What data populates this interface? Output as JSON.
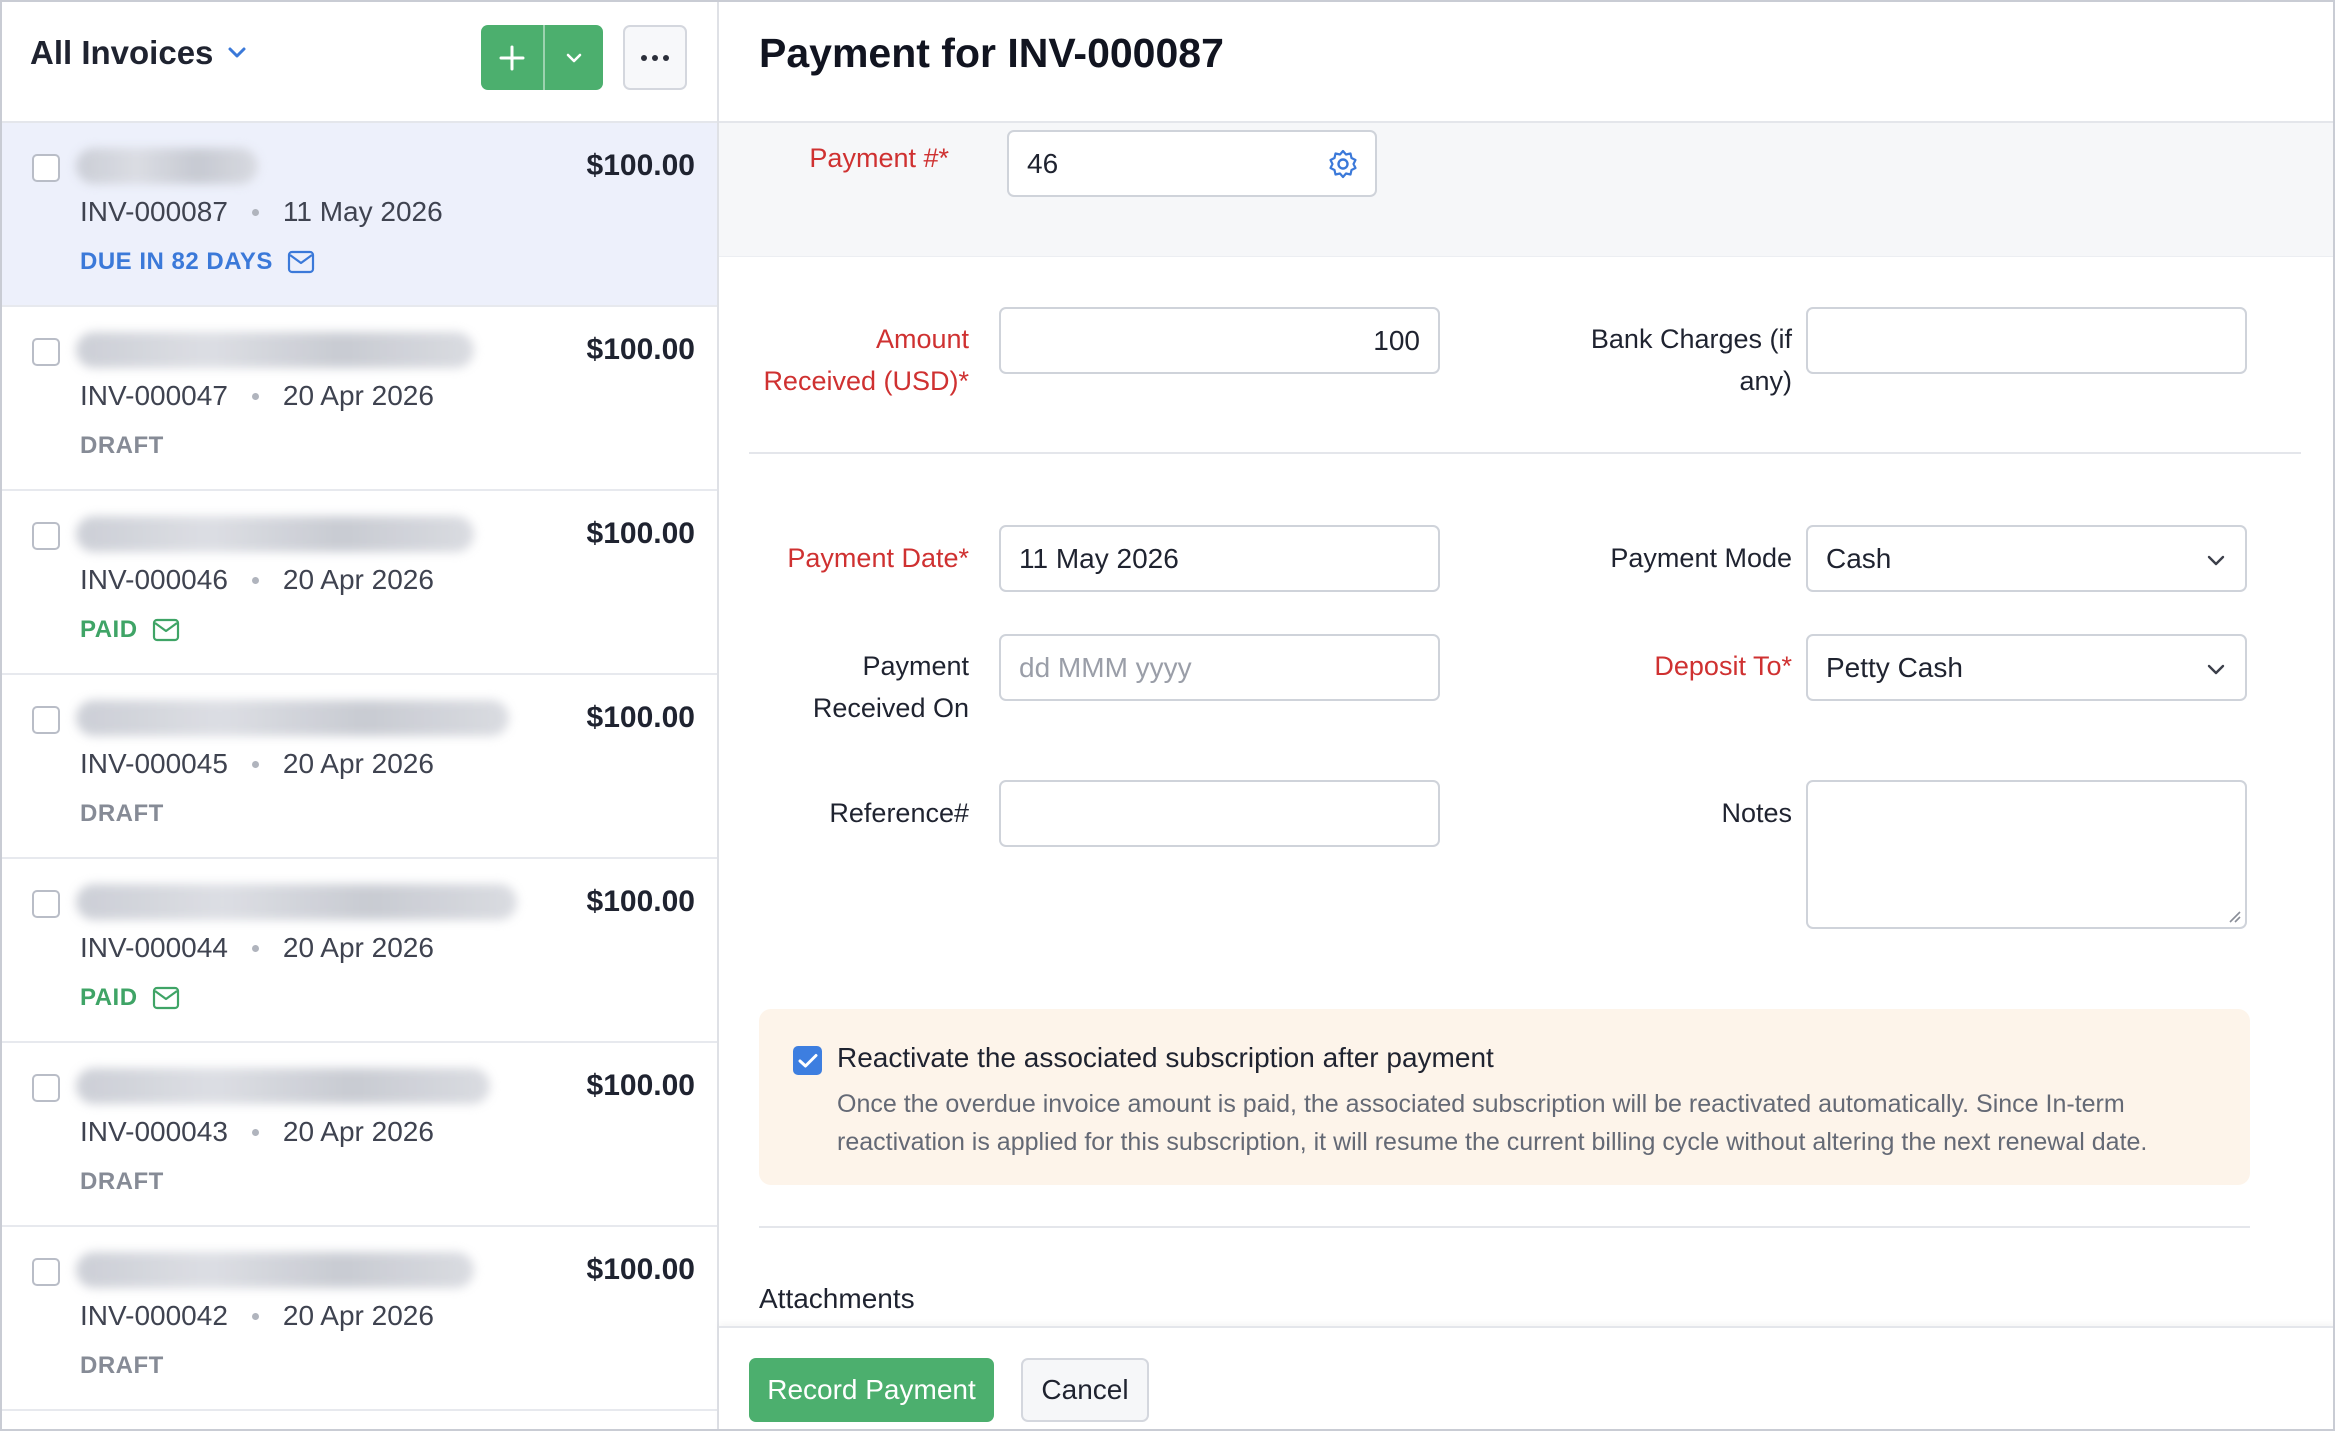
{
  "list": {
    "title": "All Invoices",
    "new_button_icon": "plus-icon",
    "more_button_icon": "ellipsis-icon",
    "invoices": [
      {
        "amount": "$100.00",
        "number": "INV-000087",
        "date": "11 May 2026",
        "status": "DUE IN 82 DAYS",
        "status_kind": "due",
        "emailed": true,
        "selected": true
      },
      {
        "amount": "$100.00",
        "number": "INV-000047",
        "date": "20 Apr 2026",
        "status": "DRAFT",
        "status_kind": "draft",
        "emailed": false,
        "selected": false
      },
      {
        "amount": "$100.00",
        "number": "INV-000046",
        "date": "20 Apr 2026",
        "status": "PAID",
        "status_kind": "paid",
        "emailed": true,
        "selected": false
      },
      {
        "amount": "$100.00",
        "number": "INV-000045",
        "date": "20 Apr 2026",
        "status": "DRAFT",
        "status_kind": "draft",
        "emailed": false,
        "selected": false
      },
      {
        "amount": "$100.00",
        "number": "INV-000044",
        "date": "20 Apr 2026",
        "status": "PAID",
        "status_kind": "paid",
        "emailed": true,
        "selected": false
      },
      {
        "amount": "$100.00",
        "number": "INV-000043",
        "date": "20 Apr 2026",
        "status": "DRAFT",
        "status_kind": "draft",
        "emailed": false,
        "selected": false
      },
      {
        "amount": "$100.00",
        "number": "INV-000042",
        "date": "20 Apr 2026",
        "status": "DRAFT",
        "status_kind": "draft",
        "emailed": false,
        "selected": false
      }
    ]
  },
  "form": {
    "title": "Payment for INV-000087",
    "payment_number": {
      "label": "Payment #*",
      "value": "46"
    },
    "amount_received": {
      "label_line1": "Amount",
      "label_line2": "Received (USD)*",
      "value": "100"
    },
    "bank_charges": {
      "label_line1": "Bank Charges (if",
      "label_line2": "any)",
      "value": ""
    },
    "payment_date": {
      "label": "Payment Date*",
      "value": "11 May 2026"
    },
    "payment_mode": {
      "label": "Payment Mode",
      "value": "Cash"
    },
    "payment_received_on": {
      "label_line1": "Payment",
      "label_line2": "Received On",
      "placeholder": "dd MMM yyyy"
    },
    "deposit_to": {
      "label": "Deposit To*",
      "value": "Petty Cash"
    },
    "reference": {
      "label": "Reference#",
      "value": ""
    },
    "notes": {
      "label": "Notes",
      "value": ""
    },
    "reactivate": {
      "checked": true,
      "title": "Reactivate the associated subscription after payment",
      "body": "Once the overdue invoice amount is paid, the associated subscription will be reactivated automatically. Since In-term reactivation is applied for this subscription, it will resume the current billing cycle without altering the next renewal date."
    },
    "attachments_label": "Attachments"
  },
  "footer": {
    "record_label": "Record Payment",
    "cancel_label": "Cancel"
  },
  "colors": {
    "accent_green": "#4caf6e",
    "required_red": "#cf3131",
    "due_blue": "#3b79d9",
    "paid_green": "#3fa466",
    "draft_gray": "#868b96",
    "notice_bg": "#fdf4ea"
  }
}
